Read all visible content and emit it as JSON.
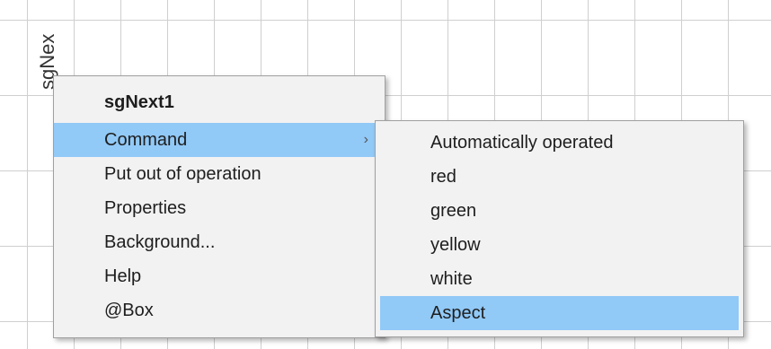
{
  "canvas_label": "sgNex",
  "context_menu": {
    "title": "sgNext1",
    "items": [
      {
        "label": "Command",
        "has_submenu": true
      },
      {
        "label": "Put out of operation"
      },
      {
        "label": "Properties"
      },
      {
        "label": "Background..."
      },
      {
        "label": "Help"
      },
      {
        "label": "@Box"
      }
    ]
  },
  "submenu": {
    "items": [
      {
        "label": "Automatically operated"
      },
      {
        "label": "red"
      },
      {
        "label": "green"
      },
      {
        "label": "yellow"
      },
      {
        "label": "white"
      },
      {
        "label": "Aspect"
      }
    ]
  },
  "colors": {
    "highlight": "#91c9f7",
    "menu_background": "#f2f2f2",
    "grid_line": "#cfcfcf"
  },
  "icons": {
    "submenu_arrow": "chevron-right-icon"
  },
  "arrow_glyph": "›"
}
